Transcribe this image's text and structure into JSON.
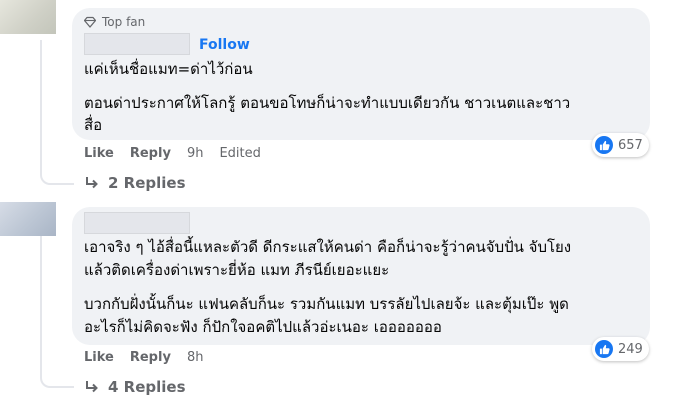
{
  "comments": [
    {
      "badge": "Top fan",
      "follow": "Follow",
      "paragraphs": [
        [
          "แค่เห็นชื่อแมท=ด่าไว้ก่อน"
        ],
        [
          "ตอนด่าประกาศให้โลกรู้ ตอนขอโทษก็น่าจะทำแบบเดียวกัน ชาวเนตและชาว",
          "สื่อ"
        ]
      ],
      "actions": {
        "like": "Like",
        "reply": "Reply",
        "time": "9h",
        "edited": "Edited"
      },
      "reaction_count": "657",
      "replies": "2 Replies"
    },
    {
      "paragraphs": [
        [
          "เอาจริง ๆ ไอ้สื่อนี้แหละตัวดี ดีกระแสให้คนด่า คือก็น่าจะรู้ว่าคนจับปั่น จับโยง",
          "แล้วติดเครื่องด่าเพราะยี่ห้อ แมท ภีรนีย์เยอะแยะ"
        ],
        [
          "บวกกับฝั่งนั้นก็นะ แฟนคลับก็นะ รวมกันแมท บรรลัยไปเลยจ้ะ และตุ้มเป๊ะ พูด",
          "อะไรก็ไม่คิดจะฟัง ก็ปักใจอคติไปแล้วอ่ะเนอะ เอออออออ"
        ]
      ],
      "actions": {
        "like": "Like",
        "reply": "Reply",
        "time": "8h"
      },
      "reaction_count": "249",
      "replies": "4 Replies"
    }
  ],
  "colors": {
    "bubble": "#f0f2f5",
    "link": "#1877f2",
    "meta": "#65676b"
  }
}
